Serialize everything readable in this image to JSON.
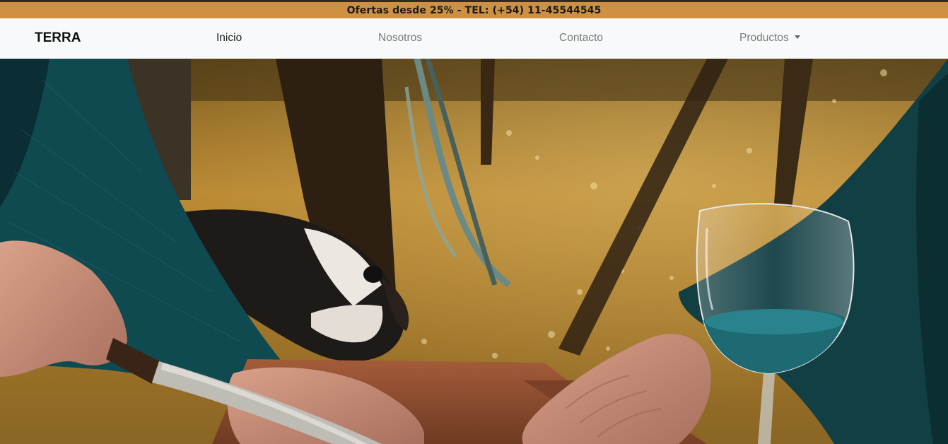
{
  "promo": {
    "text": "Ofertas desde 25% - TEL: (+54) 11-45544545"
  },
  "navbar": {
    "brand": "TERRA",
    "links": [
      {
        "label": "Inicio",
        "active": true
      },
      {
        "label": "Nosotros",
        "active": false
      },
      {
        "label": "Contacto",
        "active": false
      },
      {
        "label": "Productos",
        "active": false,
        "dropdown": true
      }
    ]
  },
  "hero": {
    "image": "people-sharing-wine-and-food-outdoors-with-dog",
    "colors": {
      "field": "#b8862e",
      "sweater": "#0f4a50",
      "wine": "#1d6a72",
      "table": "#8c4a2f"
    }
  }
}
